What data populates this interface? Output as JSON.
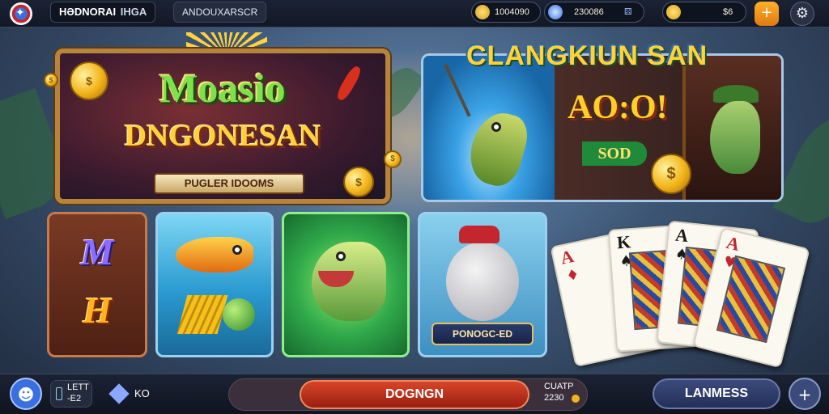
{
  "topbar": {
    "brand": "HƏDNORAI",
    "brand_tag": "IHGA",
    "sub_label": "ANDOUXARSCR",
    "resources": [
      {
        "icon": "coin-icon",
        "value": "1004090"
      },
      {
        "icon": "gem-icon",
        "value": "230086"
      },
      {
        "icon": "gold-bag-icon",
        "value": "$6"
      }
    ],
    "add_icon": "plus-icon",
    "settings_icon": "gear-icon"
  },
  "hero_banner": {
    "title_line1": "Moasio",
    "title_line2": "DNGONESAN",
    "ribbon": "PUGLER IDOOMS"
  },
  "promo_banner": {
    "title": "CLANGKIUN SAN",
    "amount": "AO:O!",
    "sub_amount": "SOD"
  },
  "tiles": [
    {
      "name": "mahjong-game-tile",
      "line1": "M",
      "line2": "H"
    },
    {
      "name": "golden-fish-game-tile"
    },
    {
      "name": "bass-fish-game-tile"
    },
    {
      "name": "seal-game-tile",
      "plate": "PONOGC-ED"
    }
  ],
  "cards": [
    {
      "rank": "A",
      "suit": "♦",
      "color": "#c4262f"
    },
    {
      "rank": "K",
      "suit": "♠",
      "color": "#1a1a1a"
    },
    {
      "rank": "A",
      "suit": "♠",
      "color": "#1a1a1a"
    },
    {
      "rank": "A",
      "suit": "♥",
      "color": "#c4262f"
    }
  ],
  "bottombar": {
    "level_label": "LETT",
    "level_value": "-E2",
    "diamond_label": "KO",
    "main_button": "DOGNGN",
    "counter_label": "CUATP",
    "counter_value": "2230",
    "side_button": "LANMESS",
    "plus_icon": "plus-icon"
  },
  "colors": {
    "accent_gold": "#ffd23a",
    "accent_green": "#7ee04a",
    "main_red": "#c4342a",
    "panel_blue": "#2a9ad0"
  }
}
